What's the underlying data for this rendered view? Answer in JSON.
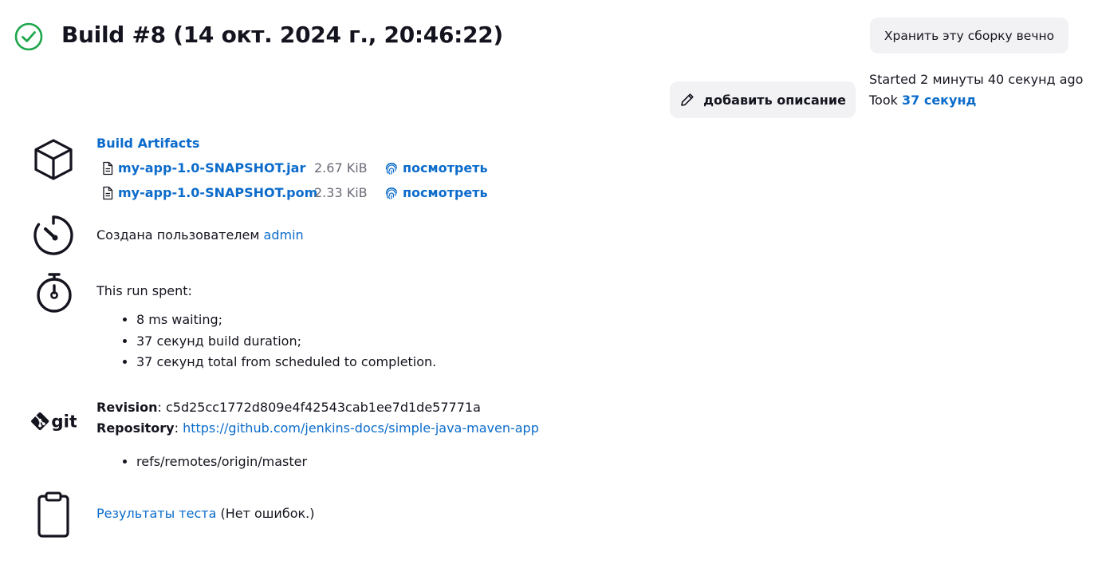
{
  "header": {
    "title": "Build #8 (14 окт. 2024 г., 20:46:22)",
    "status_icon": "check-circle-icon",
    "status_color": "#1ea64b"
  },
  "actions": {
    "keep_label": "Хранить эту сборку вечно",
    "add_description_label": "добавить описание"
  },
  "timing": {
    "started_label": "Started 2 минуты 40 секунд ago",
    "took_prefix": "Took",
    "took_value": "37 секунд"
  },
  "artifacts": {
    "title": "Build Artifacts",
    "items": [
      {
        "name": "my-app-1.0-SNAPSHOT.jar",
        "size": "2.67 KiB",
        "view_label": "посмотреть"
      },
      {
        "name": "my-app-1.0-SNAPSHOT.pom",
        "size": "2.33 KiB",
        "view_label": "посмотреть"
      }
    ]
  },
  "created": {
    "prefix": "Создана пользователем",
    "user": "admin"
  },
  "spent": {
    "title": "This run spent:",
    "items": [
      "8 ms waiting;",
      "37 секунд build duration;",
      "37 секунд total from scheduled to completion."
    ]
  },
  "git": {
    "revision_label": "Revision",
    "revision_value": "c5d25cc1772d809e4f42543cab1ee7d1de57771a",
    "repository_label": "Repository",
    "repository_url": "https://github.com/jenkins-docs/simple-java-maven-app",
    "branches": [
      "refs/remotes/origin/master"
    ],
    "logo_text": "git"
  },
  "tests": {
    "link_label": "Результаты теста",
    "suffix": "(Нет ошибок.)"
  },
  "colors": {
    "link": "#0b6bcb",
    "button_bg": "#f2f2f4",
    "text": "#14141f",
    "muted": "#6b6b78"
  }
}
